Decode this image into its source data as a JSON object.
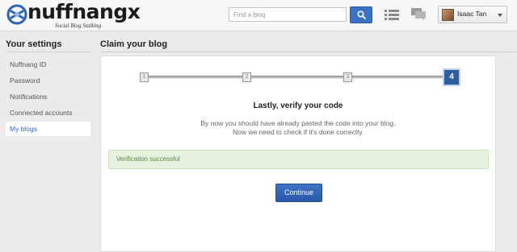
{
  "header": {
    "logo_text": "nuffnangx",
    "logo_tagline": "Social Blog Stalking",
    "search_placeholder": "Find a blog",
    "user_name": "Isaac Tan",
    "brand_color": "#3b73c4"
  },
  "sidebar": {
    "title": "Your settings",
    "items": [
      {
        "label": "Nuffnang ID",
        "active": false
      },
      {
        "label": "Password",
        "active": false
      },
      {
        "label": "Notifications",
        "active": false
      },
      {
        "label": "Connected accounts",
        "active": false
      },
      {
        "label": "My blogs",
        "active": true
      }
    ]
  },
  "main": {
    "title": "Claim your blog",
    "steps": [
      "1",
      "2",
      "3",
      "4"
    ],
    "current_step": 4,
    "heading": "Lastly, verify your code",
    "description_line1": "By now you should have already pasted the code into your blog.",
    "description_line2": "Now we need to check if it's done correctly.",
    "success_message": "Verification successful",
    "continue_label": "Continue"
  },
  "icons": {
    "search": "search-icon",
    "list": "list-icon",
    "chat": "chat-icon",
    "caret": "chevron-down-icon"
  }
}
